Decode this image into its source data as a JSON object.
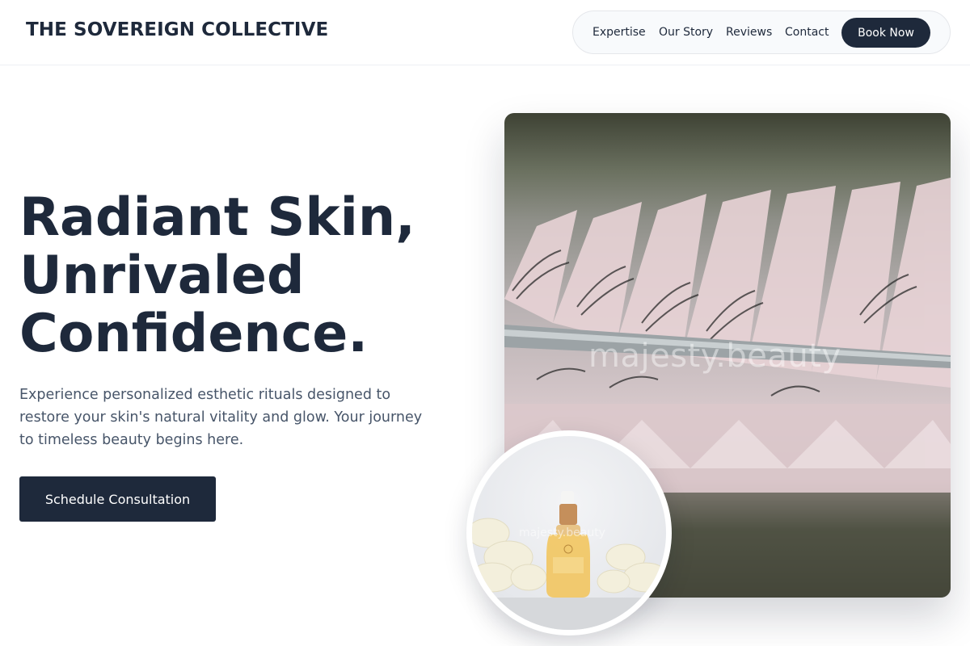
{
  "header": {
    "brand": "THE SOVEREIGN COLLECTIVE",
    "nav": [
      {
        "label": "Expertise"
      },
      {
        "label": "Our Story"
      },
      {
        "label": "Reviews"
      },
      {
        "label": "Contact"
      }
    ],
    "cta_label": "Book Now"
  },
  "hero": {
    "headline_lines": [
      "Radiant Skin,",
      "Unrivaled",
      "Confidence."
    ],
    "subtext": "Experience personalized esthetic rituals designed to restore your skin's natural vitality and glow. Your journey to timeless beauty begins here.",
    "cta_label": "Schedule Consultation",
    "image_watermark": "majesty.beauty",
    "inset_watermark": "majesty.beauty"
  },
  "colors": {
    "primary": "#1e293b",
    "body_text": "#475569",
    "nav_bg": "#f8fafc",
    "background": "#ffffff"
  }
}
